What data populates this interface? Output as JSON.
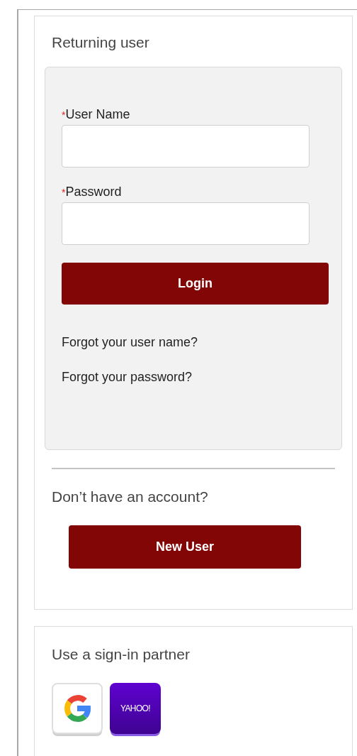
{
  "returning_user": {
    "title": "Returning user",
    "fields": [
      {
        "marker": "*",
        "label": "User Name"
      },
      {
        "marker": "*",
        "label": "Password"
      }
    ],
    "login_button": "Login",
    "links": [
      "Forgot your user name?",
      "Forgot your password?"
    ]
  },
  "new_account": {
    "prompt": "Don’t have an account?",
    "button": "New User"
  },
  "sign_in_partner": {
    "title": "Use a sign-in partner",
    "partners": [
      {
        "kind": "g"
      },
      {
        "kind": "wordmark",
        "label": "YAHOO!"
      }
    ]
  }
}
